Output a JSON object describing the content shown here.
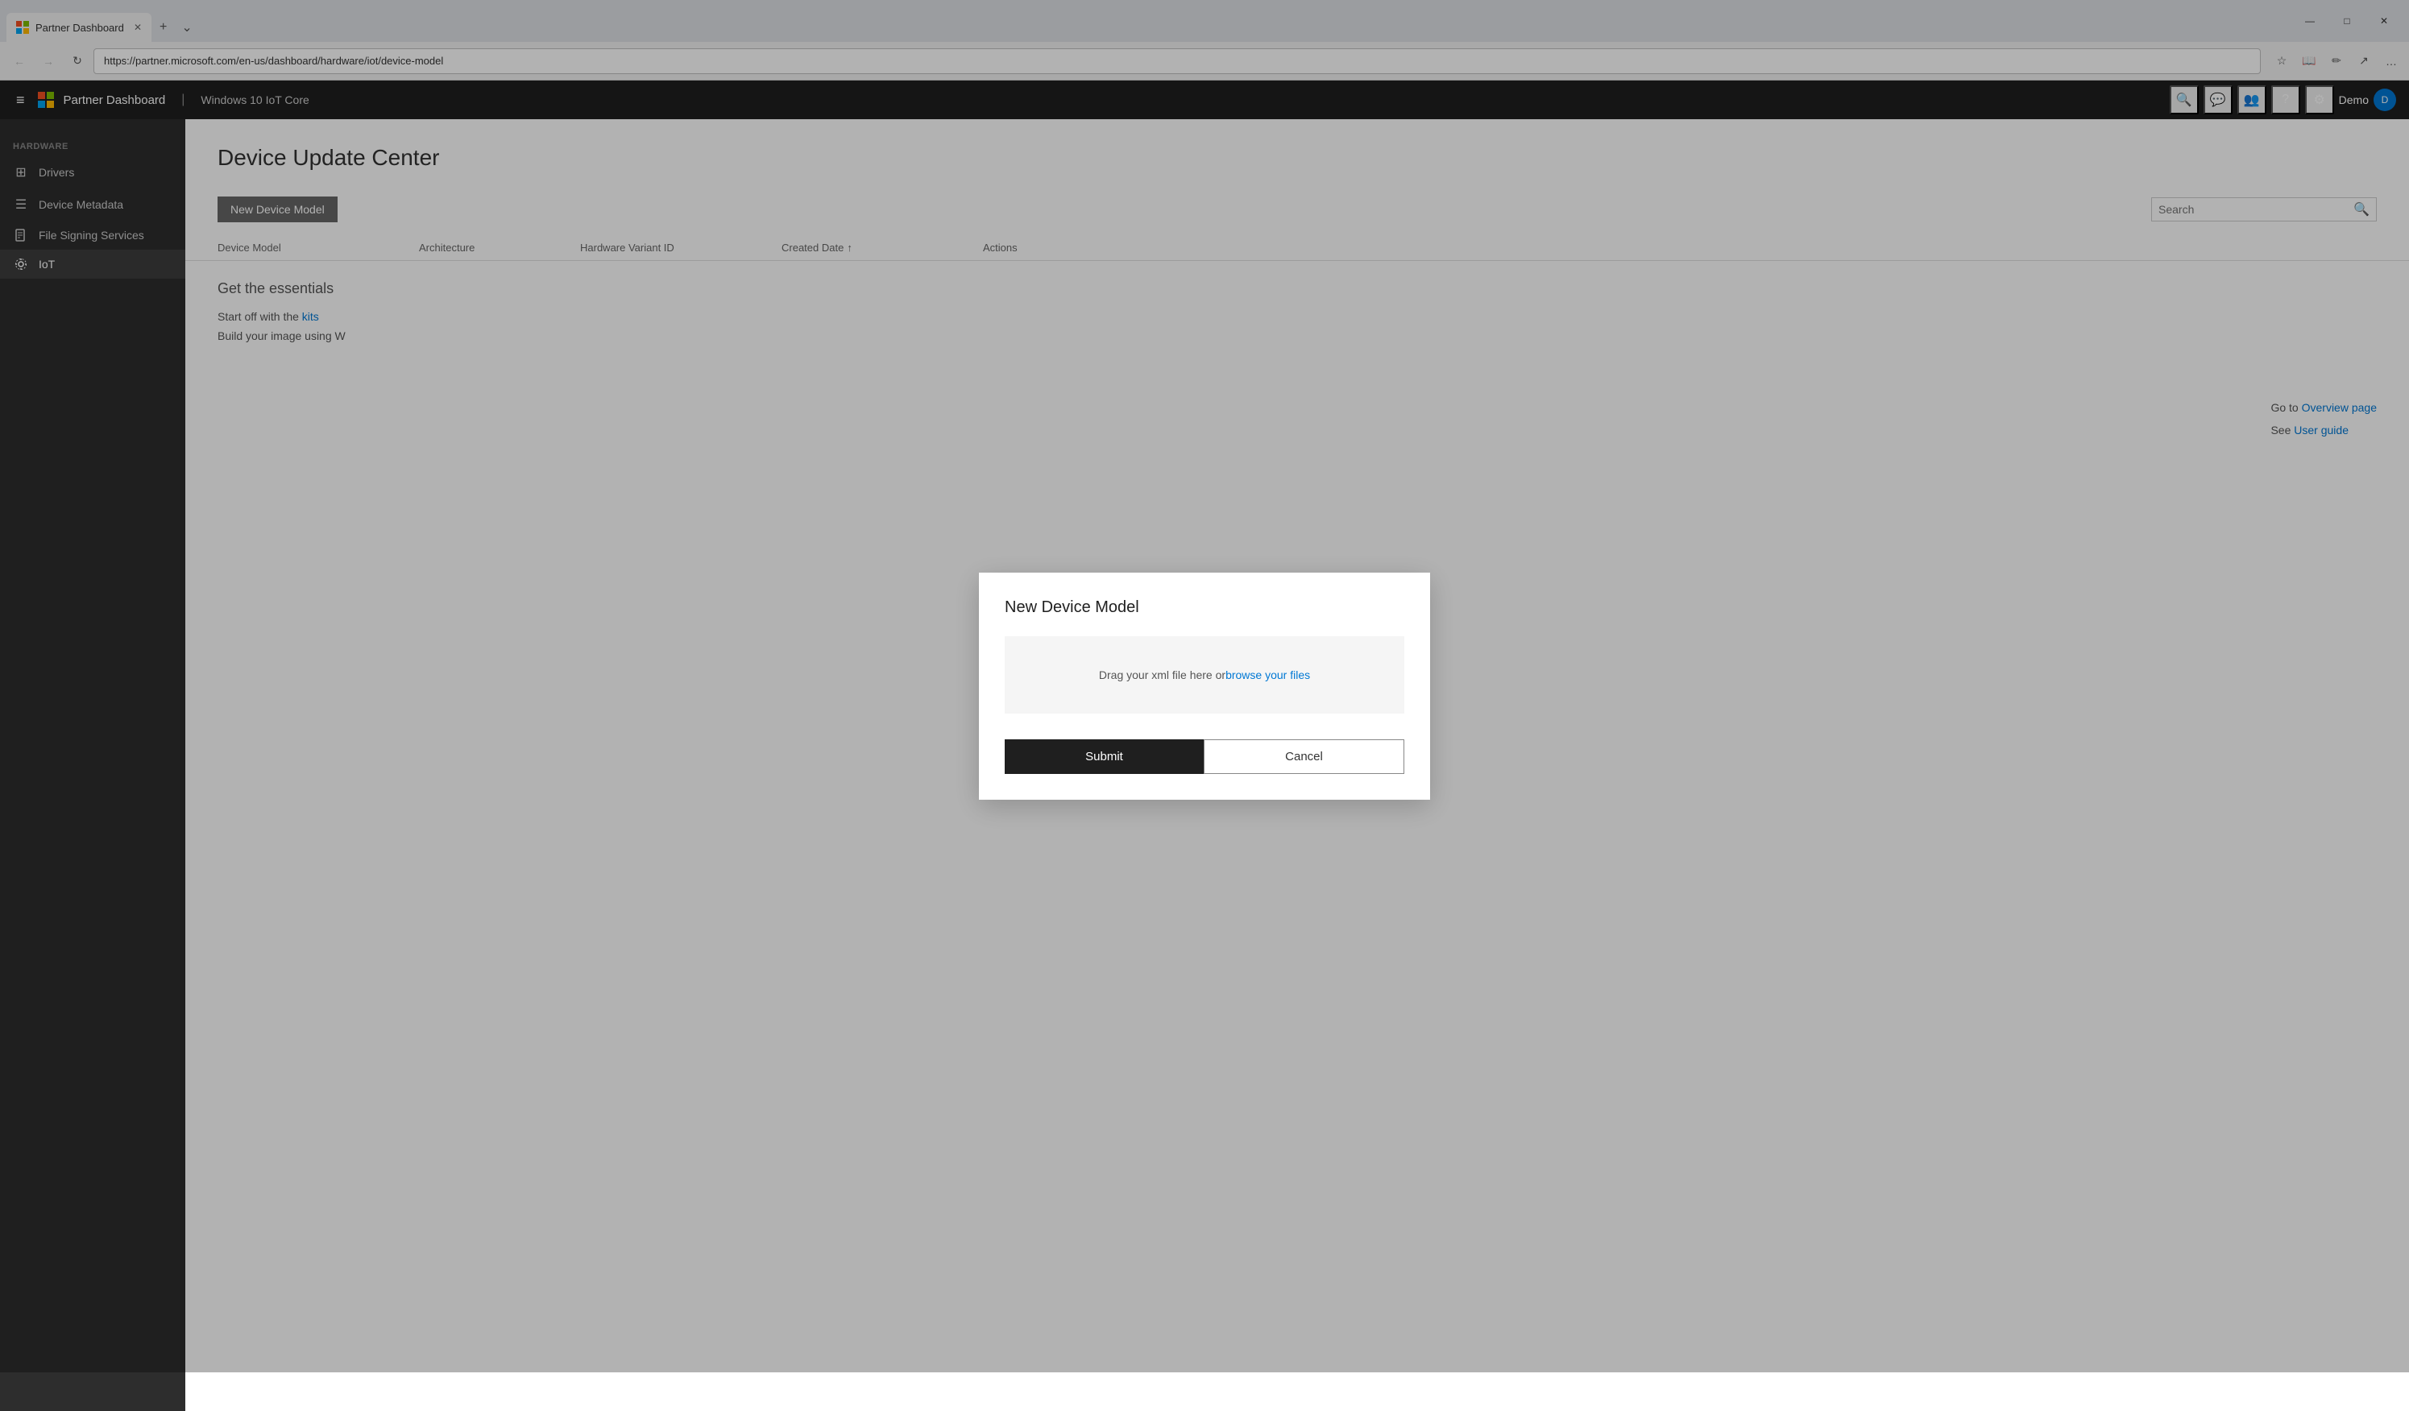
{
  "browser": {
    "tab_title": "Partner Dashboard",
    "url": "https://partner.microsoft.com/en-us/dashboard/hardware/iot/device-model",
    "controls": {
      "back": "←",
      "forward": "→",
      "refresh": "↻",
      "minimize": "—",
      "maximize": "□",
      "close": "✕"
    },
    "new_tab": "+",
    "dropdown": "⌄"
  },
  "topbar": {
    "hamburger": "≡",
    "app_title": "Partner Dashboard",
    "divider": "|",
    "app_subtitle": "Windows 10 IoT Core",
    "icons": {
      "search": "🔍",
      "chat": "💬",
      "people": "👥",
      "help": "?",
      "settings": "⚙"
    },
    "user_label": "Demo",
    "user_initial": "D"
  },
  "sidebar": {
    "section_label": "HARDWARE",
    "items": [
      {
        "id": "drivers",
        "label": "Drivers",
        "icon": "⊞"
      },
      {
        "id": "device-metadata",
        "label": "Device Metadata",
        "icon": "☰"
      },
      {
        "id": "file-signing",
        "label": "File Signing Services",
        "icon": "⊡"
      },
      {
        "id": "iot",
        "label": "IoT",
        "icon": "⚙",
        "active": true
      }
    ]
  },
  "page": {
    "title": "Device Update Center",
    "toolbar": {
      "new_device_btn": "New Device Model",
      "search_placeholder": "Search"
    },
    "table": {
      "columns": [
        {
          "id": "device-model",
          "label": "Device Model"
        },
        {
          "id": "architecture",
          "label": "Architecture"
        },
        {
          "id": "hardware-variant-id",
          "label": "Hardware Variant ID"
        },
        {
          "id": "created-date",
          "label": "Created Date",
          "sorted": true,
          "sort_icon": "↑"
        },
        {
          "id": "actions",
          "label": "Actions"
        }
      ]
    },
    "content": {
      "section_title": "Get the essentials",
      "row1_prefix": "Start off with the ",
      "row1_link": "kits",
      "row2_prefix": "Build your image using W"
    },
    "side_info": {
      "row1_prefix": "Go to ",
      "row1_link": "Overview page",
      "row2_prefix": "See ",
      "row2_link": "User guide"
    }
  },
  "dialog": {
    "title": "New Device Model",
    "dropzone_text": "Drag your xml file here or ",
    "dropzone_link": "browse your files",
    "submit_label": "Submit",
    "cancel_label": "Cancel"
  },
  "colors": {
    "accent_blue": "#0078d4",
    "sidebar_bg": "#2d2d2d",
    "topbar_bg": "#1f1f1f",
    "active_sidebar": "#3d3d3d"
  }
}
